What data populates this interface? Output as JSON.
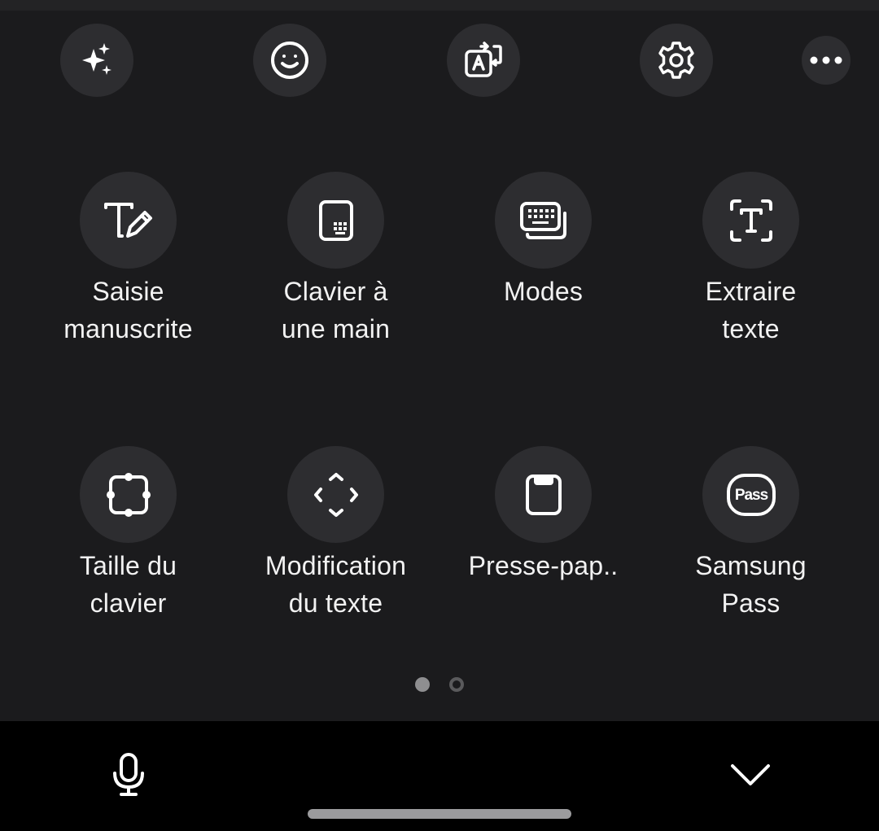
{
  "toolbar": {
    "buttons": [
      {
        "icon": "sparkles-icon"
      },
      {
        "icon": "emoji-icon"
      },
      {
        "icon": "translate-icon"
      },
      {
        "icon": "gear-icon"
      },
      {
        "icon": "more-icon"
      }
    ]
  },
  "grid": {
    "pages": {
      "count": 2,
      "active": 1
    },
    "items": [
      {
        "icon": "handwriting-icon",
        "label": "Saisie\nmanuscrite"
      },
      {
        "icon": "one-hand-keyboard-icon",
        "label": "Clavier à\nune main"
      },
      {
        "icon": "keyboard-modes-icon",
        "label": "Modes"
      },
      {
        "icon": "extract-text-icon",
        "label": "Extraire\ntexte"
      },
      {
        "icon": "resize-icon",
        "label": "Taille du\nclavier"
      },
      {
        "icon": "move-arrows-icon",
        "label": "Modification\ndu texte"
      },
      {
        "icon": "clipboard-icon",
        "label": "Presse-pap.."
      },
      {
        "icon": "samsung-pass-icon",
        "label": "Samsung\nPass",
        "icon_text": "Pass"
      }
    ]
  },
  "bottom_bar": {
    "left_icon": "microphone-icon",
    "right_icon": "chevron-down-icon"
  },
  "colors": {
    "background": "#1b1b1d",
    "button": "#2d2d30",
    "bottom_bar": "#000000",
    "text": "#f2f2f2"
  }
}
